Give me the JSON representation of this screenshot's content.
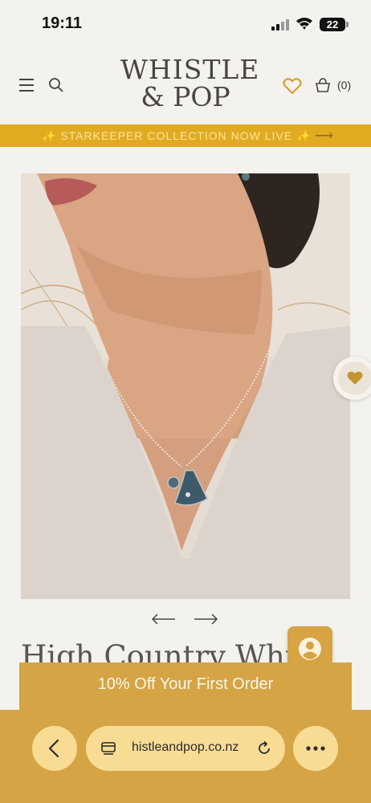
{
  "status_bar": {
    "time": "19:11",
    "battery": "22"
  },
  "header": {
    "logo_line1": "WHISTLE",
    "logo_line2": "& POP",
    "cart_count": "(0)"
  },
  "announcement": {
    "text": "✨ STARKEEPER COLLECTION NOW LIVE ✨",
    "arrow": "⟶"
  },
  "carousel": {
    "prev": "⟵",
    "next": "⟶"
  },
  "product": {
    "title": "High Country Whistle"
  },
  "promo": {
    "text": "10% Off Your First Order"
  },
  "browser": {
    "url": "histleandpop.co.nz"
  },
  "icons": [
    "menu-icon",
    "search-icon",
    "heart-icon",
    "bag-icon",
    "wishlist-heart-icon",
    "account-icon",
    "back-icon",
    "tabs-icon",
    "reload-icon",
    "more-icon"
  ],
  "colors": {
    "accent": "#e1ab21",
    "promo": "#d5a445",
    "pill": "#f9dc94",
    "background": "#f4f2ee"
  }
}
